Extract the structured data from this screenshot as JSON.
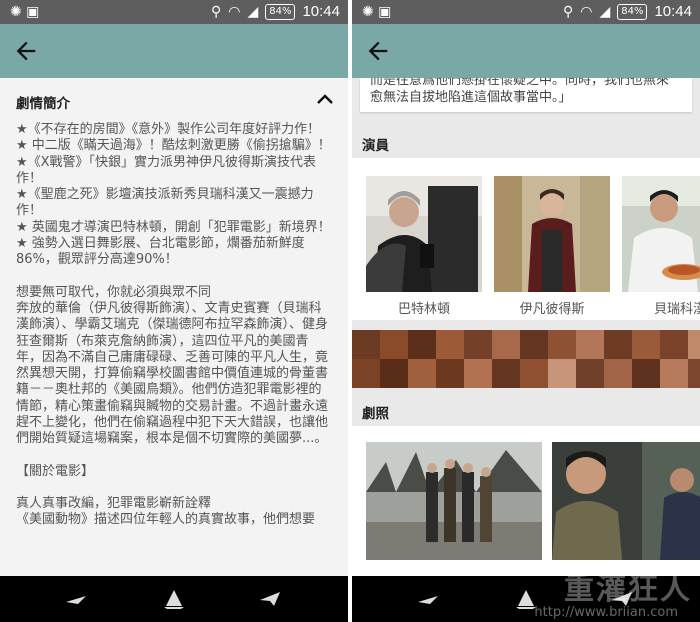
{
  "status": {
    "battery": "84%",
    "time": "10:44"
  },
  "left": {
    "synopsis_title": "劇情簡介",
    "lines": [
      "★《不存在的房間》《意外》製作公司年度好評力作！",
      "★ 中二版《瞞天過海》！酷炫刺激更勝《偷拐搶騙》！",
      "★《X戰警》「快銀」實力派男神伊凡彼得斯演技代表作！",
      "★《聖鹿之死》影壇演技派新秀貝瑞科漢又一震撼力作！",
      "★ 英國鬼才導演巴特林頓，開創「犯罪電影」新境界！",
      "★ 強勢入選日舞影展、台北電影節，爛番茄新鮮度86%，觀眾評分高達90%！"
    ],
    "paragraph": "想要無可取代，你就必須與眾不同\n奔放的華倫（伊凡彼得斯飾演）、文青史賓賽（貝瑞科漢飾演）、學霸艾瑞克（傑瑞德阿布拉罕森飾演）、健身狂查爾斯（布萊克詹納飾演），這四位平凡的美國青年，因為不滿自己庸庸碌碌、乏善可陳的平凡人生，竟然異想天開，打算偷竊學校圖書館中價值連城的骨董書籍－－奧杜邦的《美國鳥類》。他們仿造犯罪電影裡的情節，精心策畫偷竊與贓物的交易計畫。不過計畫永遠趕不上變化，他們在偷竊過程中犯下天大錯誤，也讓他們開始質疑這場竊案，根本是個不切實際的美國夢...。",
    "about_heading": "【關於電影】",
    "about_line1": "真人真事改編，犯罪電影嶄新詮釋",
    "about_line2": "《美國動物》描述四位年輕人的真實故事，他們想要"
  },
  "right": {
    "quote_line1": "而是往意爲他們懸掛在懷疑之中。同時，我們也無來",
    "quote_line2": "愈無法自拔地陷進這個故事當中。」",
    "cast_title": "演員",
    "cast": [
      {
        "name": "巴特林頓"
      },
      {
        "name": "伊凡彼得斯"
      },
      {
        "name": "貝瑞科漢"
      }
    ],
    "stills_title": "劇照"
  },
  "watermark": {
    "text": "重灌狂人",
    "url": "http://www.briian.com"
  },
  "colors": {
    "appbar": "#7aa8a6",
    "statusbar": "#5e5e5e",
    "navbar": "#000000"
  }
}
